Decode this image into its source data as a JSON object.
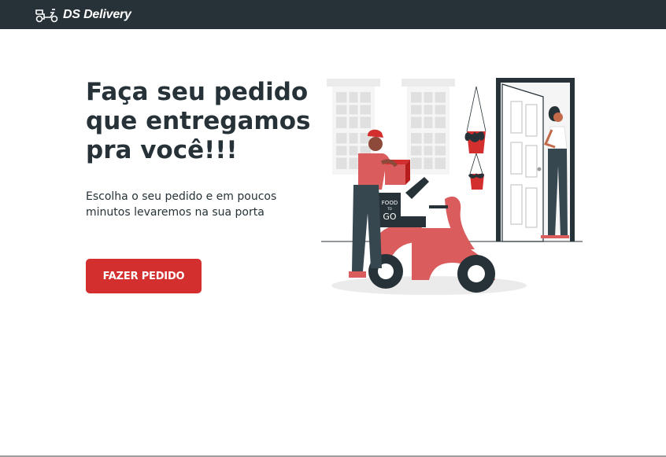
{
  "navbar": {
    "brand_name": "DS Delivery",
    "logo_icon": "scooter-icon"
  },
  "hero": {
    "title": "Faça seu pedido que entregamos pra você!!!",
    "subtitle": "Escolha o seu pedido e em poucos minutos levaremos na sua porta",
    "cta_label": "FAZER PEDIDO"
  },
  "illustration": {
    "box_line_1": "FOOD",
    "box_line_2": "TO",
    "box_line_3": "GO"
  },
  "colors": {
    "navbar": "#263238",
    "text": "#263238",
    "accent": "#DA5C5C",
    "button": "#D32F2F"
  }
}
